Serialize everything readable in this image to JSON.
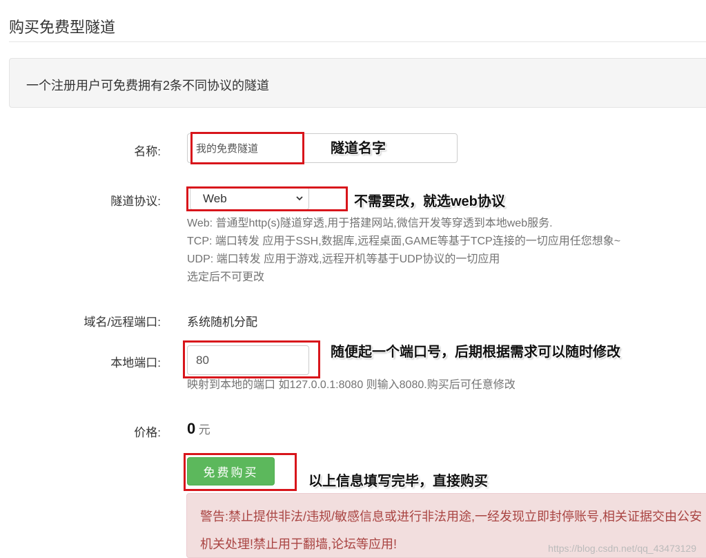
{
  "page": {
    "title": "购买免费型隧道",
    "notice": "一个注册用户可免费拥有2条不同协议的隧道"
  },
  "form": {
    "name": {
      "label": "名称:",
      "value": "我的免费隧道"
    },
    "protocol": {
      "label": "隧道协议:",
      "selected": "Web",
      "help": [
        "Web: 普通型http(s)隧道穿透,用于搭建网站,微信开发等穿透到本地web服务.",
        "TCP: 端口转发 应用于SSH,数据库,远程桌面,GAME等基于TCP连接的一切应用任您想象~",
        "UDP: 端口转发 应用于游戏,远程开机等基于UDP协议的一切应用",
        "选定后不可更改"
      ]
    },
    "domain": {
      "label": "域名/远程端口:",
      "value": "系统随机分配"
    },
    "local_port": {
      "label": "本地端口:",
      "value": "80",
      "help": "映射到本地的端口 如127.0.0.1:8080 则输入8080.购买后可任意修改"
    },
    "price": {
      "label": "价格:",
      "value": "0",
      "unit": "元"
    },
    "buy_button": "免费购买"
  },
  "warning": "警告:禁止提供非法/违规/敏感信息或进行非法用途,一经发现立即封停账号,相关证据交由公安机关处理!禁止用于翻墙,论坛等应用!",
  "annotations": {
    "name": "隧道名字",
    "protocol": "不需要改，就选web协议",
    "port": "随便起一个端口号，后期根据需求可以随时修改",
    "buy": "以上信息填写完毕，直接购买"
  },
  "watermark": "https://blog.csdn.net/qq_43473129",
  "colors": {
    "button": "#5cb85c",
    "warning_bg": "#f2dede",
    "warning_text": "#a94442",
    "annotation_box": "#d8151b"
  }
}
